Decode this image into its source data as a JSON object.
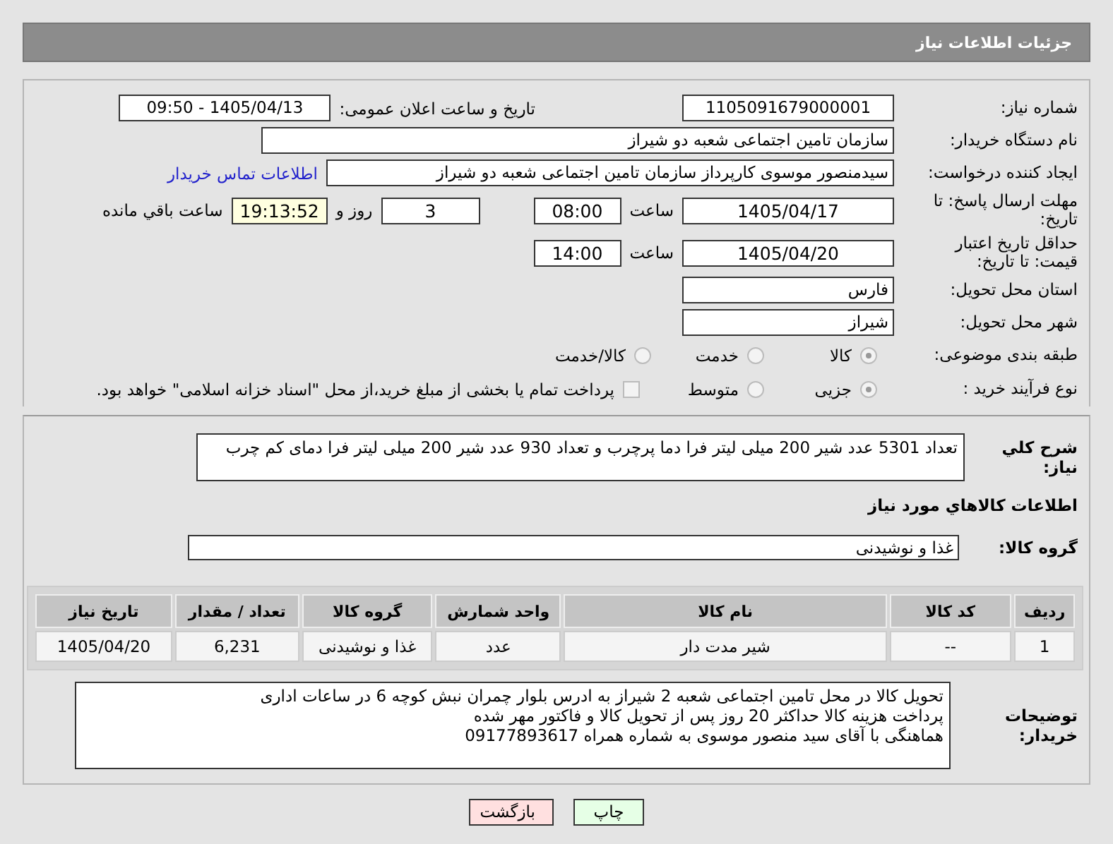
{
  "header": {
    "title": "جزئیات اطلاعات نیاز"
  },
  "need_number": {
    "label": "شماره نیاز:",
    "value": "1105091679000001"
  },
  "announce": {
    "label": "تاریخ و ساعت اعلان عمومی:",
    "value": "1405/04/13 - 09:50"
  },
  "buyer_org": {
    "label": "نام دستگاه خریدار:",
    "value": "سازمان تامین اجتماعی شعبه دو شیراز"
  },
  "requester": {
    "label": "ایجاد کننده درخواست:",
    "value": "سیدمنصور موسوی کارپرداز سازمان تامین اجتماعی شعبه دو شیراز",
    "link": "اطلاعات تماس خریدار"
  },
  "deadline": {
    "label": "مهلت ارسال پاسخ: تا تاریخ:",
    "date": "1405/04/17",
    "time_label": "ساعت",
    "time": "08:00",
    "days": "3",
    "days_label": "روز و",
    "remaining": "19:13:52",
    "remaining_label": "ساعت باقي مانده"
  },
  "price_validity": {
    "label": "حداقل تاریخ اعتبار قیمت: تا تاریخ:",
    "date": "1405/04/20",
    "time_label": "ساعت",
    "time": "14:00"
  },
  "province": {
    "label": "استان محل تحویل:",
    "value": "فارس"
  },
  "city": {
    "label": "شهر محل تحویل:",
    "value": "شیراز"
  },
  "category": {
    "label": "طبقه بندی موضوعی:",
    "options": [
      {
        "text": "کالا",
        "selected": true
      },
      {
        "text": "خدمت",
        "selected": false
      },
      {
        "text": "کالا/خدمت",
        "selected": false
      }
    ]
  },
  "process": {
    "label": "نوع فرآیند خرید :",
    "options": [
      {
        "text": "جزیی",
        "selected": true
      },
      {
        "text": "متوسط",
        "selected": false
      }
    ],
    "payment": {
      "text": "پرداخت تمام یا بخشی از مبلغ خرید،از محل \"اسناد خزانه اسلامی\" خواهد بود.",
      "checked": false
    }
  },
  "description": {
    "label": "شرح کلي نیاز:",
    "value": "تعداد 5301 عدد شیر 200 میلی لیتر فرا دما پرچرب و تعداد 930 عدد شیر 200 میلی لیتر فرا دمای کم چرب"
  },
  "items_title": "اطلاعات کالاهاي مورد نیاز",
  "goods_group": {
    "label": "گروه کالا:",
    "value": "غذا و نوشیدنی"
  },
  "table": {
    "columns": [
      "ردیف",
      "کد کالا",
      "نام کالا",
      "واحد شمارش",
      "گروه کالا",
      "تعداد / مقدار",
      "تاریخ نیاز"
    ],
    "rows": [
      {
        "cells": [
          "1",
          "--",
          "شیر مدت دار",
          "عدد",
          "غذا و نوشیدنی",
          "6,231",
          "1405/04/20"
        ]
      }
    ]
  },
  "buyer_notes": {
    "label": "توضیحات خریدار:",
    "value": "تحویل کالا در محل تامین اجتماعی شعبه 2 شیراز به ادرس بلوار چمران نبش کوچه 6 در ساعات اداری\nپرداخت هزینه کالا  حداکثر 20 روز پس از تحویل کالا و فاکتور مهر شده\nهماهنگی با آقای سید منصور موسوی به شماره همراه 09177893617"
  },
  "buttons": [
    {
      "kind": "print",
      "label": "چاپ"
    },
    {
      "kind": "back",
      "label": "بازگشت"
    }
  ]
}
